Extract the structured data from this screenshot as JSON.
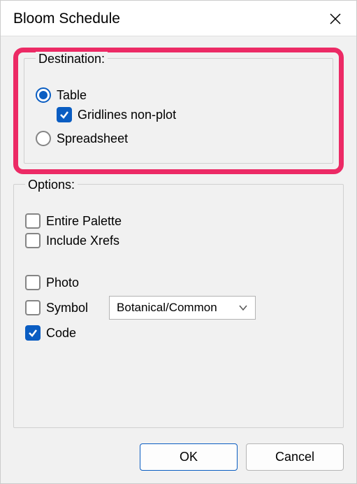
{
  "title": "Bloom Schedule",
  "destination": {
    "legend": "Destination:",
    "table": {
      "label": "Table",
      "checked": true
    },
    "gridlines": {
      "label": "Gridlines non-plot",
      "checked": true
    },
    "spreadsheet": {
      "label": "Spreadsheet",
      "checked": false
    }
  },
  "options": {
    "legend": "Options:",
    "entire_palette": {
      "label": "Entire Palette",
      "checked": false
    },
    "include_xrefs": {
      "label": "Include Xrefs",
      "checked": false
    },
    "photo": {
      "label": "Photo",
      "checked": false
    },
    "symbol": {
      "label": "Symbol",
      "checked": false
    },
    "code": {
      "label": "Code",
      "checked": true
    },
    "dropdown": {
      "selected": "Botanical/Common"
    }
  },
  "buttons": {
    "ok": "OK",
    "cancel": "Cancel"
  }
}
